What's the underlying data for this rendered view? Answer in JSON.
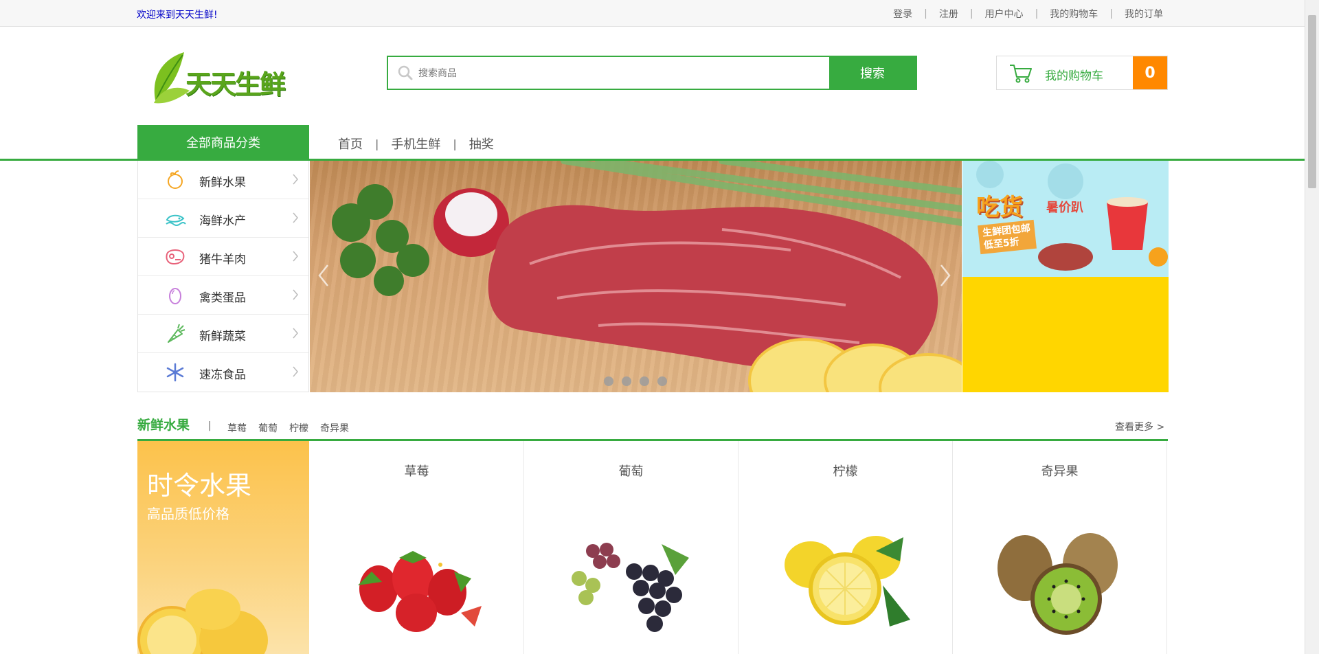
{
  "topbar": {
    "welcome": "欢迎来到天天生鲜!",
    "links": [
      "登录",
      "注册",
      "用户中心",
      "我的购物车",
      "我的订单"
    ]
  },
  "logo": {
    "text": "天天生鲜"
  },
  "search": {
    "placeholder": "搜索商品",
    "button": "搜索"
  },
  "cart": {
    "label": "我的购物车",
    "count": "0"
  },
  "nav": {
    "all_categories": "全部商品分类",
    "items": [
      "首页",
      "手机生鲜",
      "抽奖"
    ]
  },
  "categories": [
    {
      "label": "新鲜水果",
      "icon": "fruit-icon"
    },
    {
      "label": "海鲜水产",
      "icon": "seafood-icon"
    },
    {
      "label": "猪牛羊肉",
      "icon": "meat-icon"
    },
    {
      "label": "禽类蛋品",
      "icon": "egg-icon"
    },
    {
      "label": "新鲜蔬菜",
      "icon": "vegetable-icon"
    },
    {
      "label": "速冻食品",
      "icon": "frozen-icon"
    }
  ],
  "ad": {
    "title": "吃货",
    "subtitle": "暑价趴",
    "tag_line1": "生鲜团包邮",
    "tag_line2": "低至5折"
  },
  "section": {
    "title": "新鲜水果",
    "sublinks": [
      "草莓",
      "葡萄",
      "柠檬",
      "奇异果"
    ],
    "more": "查看更多 >",
    "promo_title": "时令水果",
    "promo_subtitle": "高品质低价格",
    "products": [
      "草莓",
      "葡萄",
      "柠檬",
      "奇异果"
    ]
  },
  "colors": {
    "brand_green": "#37ab40",
    "cart_orange": "#ff8800",
    "ad_yellow": "#ffd600"
  }
}
